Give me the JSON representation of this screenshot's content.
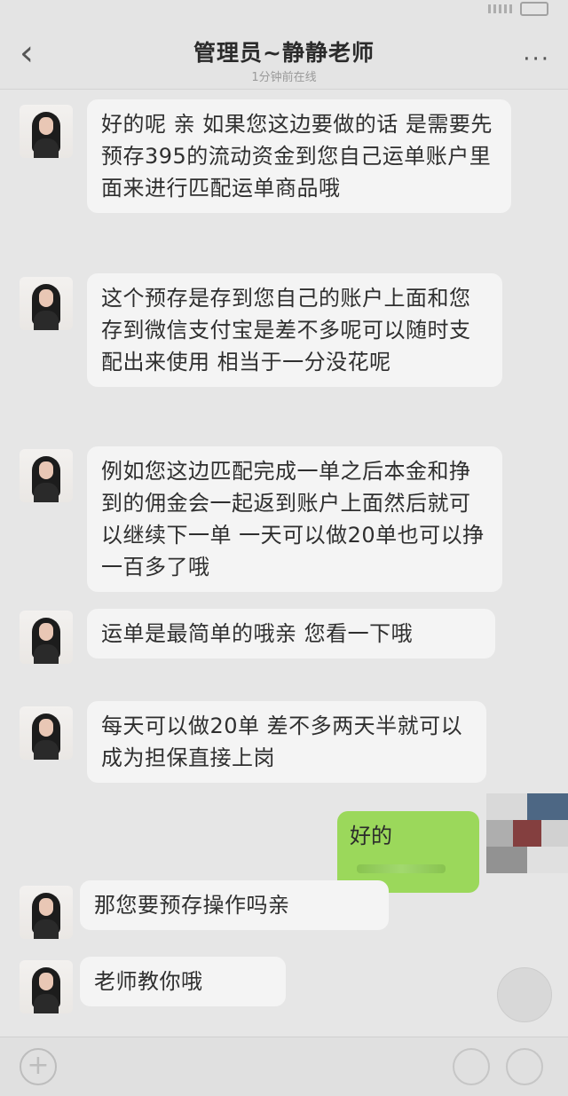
{
  "header": {
    "title": "管理员~静静老师",
    "subtitle": "1分钟前在线"
  },
  "messages": [
    {
      "sender": "other",
      "text": "好的呢 亲 如果您这边要做的话 是需要先预存395的流动资金到您自己运单账户里面来进行匹配运单商品哦"
    },
    {
      "sender": "other",
      "text": "这个预存是存到您自己的账户上面和您存到微信支付宝是差不多呢可以随时支配出来使用 相当于一分没花呢"
    },
    {
      "sender": "other",
      "text": "例如您这边匹配完成一单之后本金和挣到的佣金会一起返到账户上面然后就可以继续下一单 一天可以做20单也可以挣一百多了哦"
    },
    {
      "sender": "other",
      "text": "运单是最简单的哦亲 您看一下哦"
    },
    {
      "sender": "other",
      "text": "每天可以做20单 差不多两天半就可以成为担保直接上岗"
    },
    {
      "sender": "self",
      "text": "好的"
    },
    {
      "sender": "other",
      "text": "那您要预存操作吗亲"
    },
    {
      "sender": "other",
      "text": "老师教你哦"
    }
  ],
  "colors": {
    "background": "#e6e6e6",
    "bubble_other": "#f4f4f4",
    "bubble_self": "#9bd85b"
  }
}
